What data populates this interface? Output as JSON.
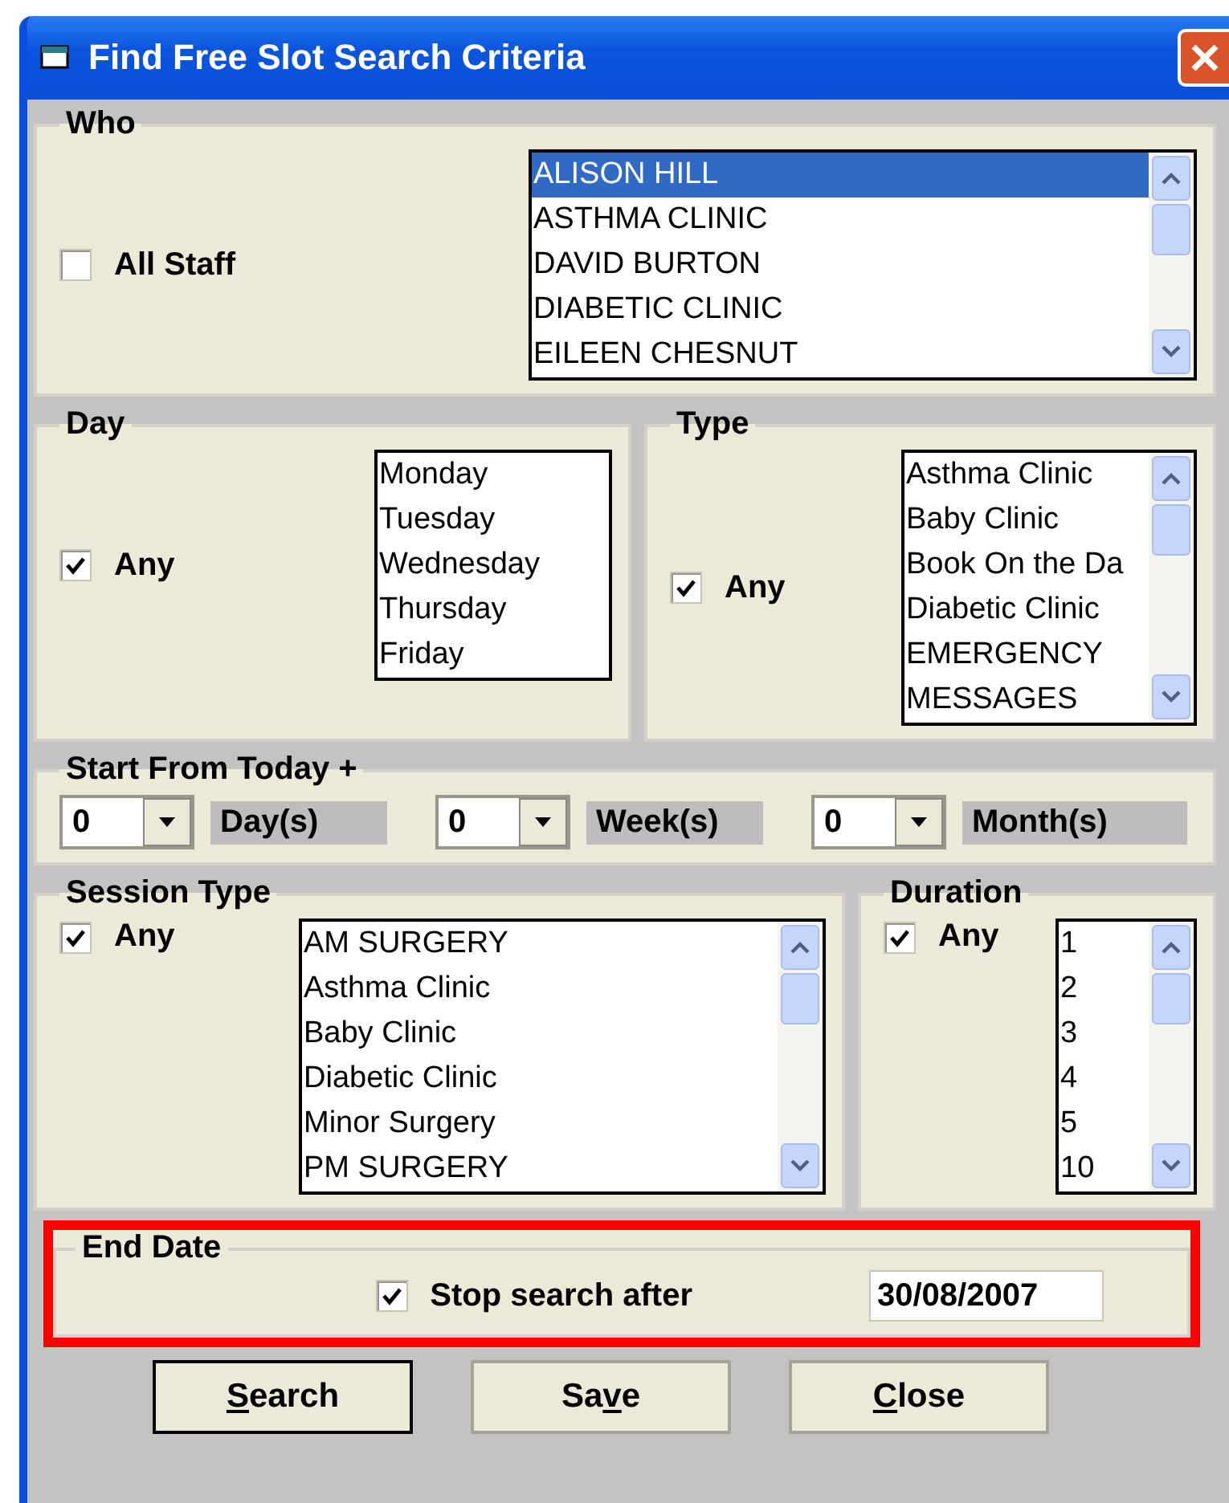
{
  "window": {
    "title": "Find Free Slot Search Criteria"
  },
  "who": {
    "legend": "Who",
    "all_staff": {
      "label": "All Staff",
      "checked": false
    },
    "staff": [
      {
        "text": "ALISON HILL",
        "selected": true
      },
      {
        "text": "ASTHMA CLINIC",
        "selected": false
      },
      {
        "text": "DAVID BURTON",
        "selected": false
      },
      {
        "text": "DIABETIC CLINIC",
        "selected": false
      },
      {
        "text": "EILEEN CHESNUT",
        "selected": false
      }
    ]
  },
  "day": {
    "legend": "Day",
    "any": {
      "label": "Any",
      "checked": true
    },
    "days": [
      {
        "text": "Monday",
        "selected": false
      },
      {
        "text": "Tuesday",
        "selected": false
      },
      {
        "text": "Wednesday",
        "selected": false
      },
      {
        "text": "Thursday",
        "selected": false
      },
      {
        "text": "Friday",
        "selected": false
      }
    ]
  },
  "type": {
    "legend": "Type",
    "any": {
      "label": "Any",
      "checked": true
    },
    "types": [
      {
        "text": "Asthma Clinic",
        "selected": false
      },
      {
        "text": "Baby Clinic",
        "selected": false
      },
      {
        "text": "Book On the  Da",
        "selected": false
      },
      {
        "text": "Diabetic Clinic",
        "selected": false
      },
      {
        "text": "EMERGENCY",
        "selected": false
      },
      {
        "text": "MESSAGES",
        "selected": false
      }
    ]
  },
  "start_from": {
    "legend": "Start From Today +",
    "fields": [
      {
        "value": "0",
        "unit": "Day(s)"
      },
      {
        "value": "0",
        "unit": "Week(s)"
      },
      {
        "value": "0",
        "unit": "Month(s)"
      }
    ]
  },
  "session_type": {
    "legend": "Session Type",
    "any": {
      "label": "Any",
      "checked": true
    },
    "sessions": [
      {
        "text": "AM SURGERY",
        "selected": false
      },
      {
        "text": "Asthma Clinic",
        "selected": false
      },
      {
        "text": "Baby Clinic",
        "selected": false
      },
      {
        "text": "Diabetic Clinic",
        "selected": false
      },
      {
        "text": "Minor Surgery",
        "selected": false
      },
      {
        "text": "PM SURGERY",
        "selected": false
      }
    ]
  },
  "duration": {
    "legend": "Duration",
    "any": {
      "label": "Any",
      "checked": true
    },
    "durations": [
      {
        "text": "1",
        "selected": false
      },
      {
        "text": "2",
        "selected": false
      },
      {
        "text": "3",
        "selected": false
      },
      {
        "text": "4",
        "selected": false
      },
      {
        "text": "5",
        "selected": false
      },
      {
        "text": "10",
        "selected": false
      }
    ]
  },
  "end_date": {
    "legend": "End Date",
    "stop": {
      "label": "Stop search after",
      "checked": true
    },
    "date": "30/08/2007"
  },
  "buttons": [
    {
      "key": "S",
      "post": "earch",
      "default": true
    },
    {
      "pre": "Sa",
      "key": "v",
      "post": "e",
      "default": false
    },
    {
      "key": "C",
      "post": "lose",
      "default": false
    }
  ]
}
